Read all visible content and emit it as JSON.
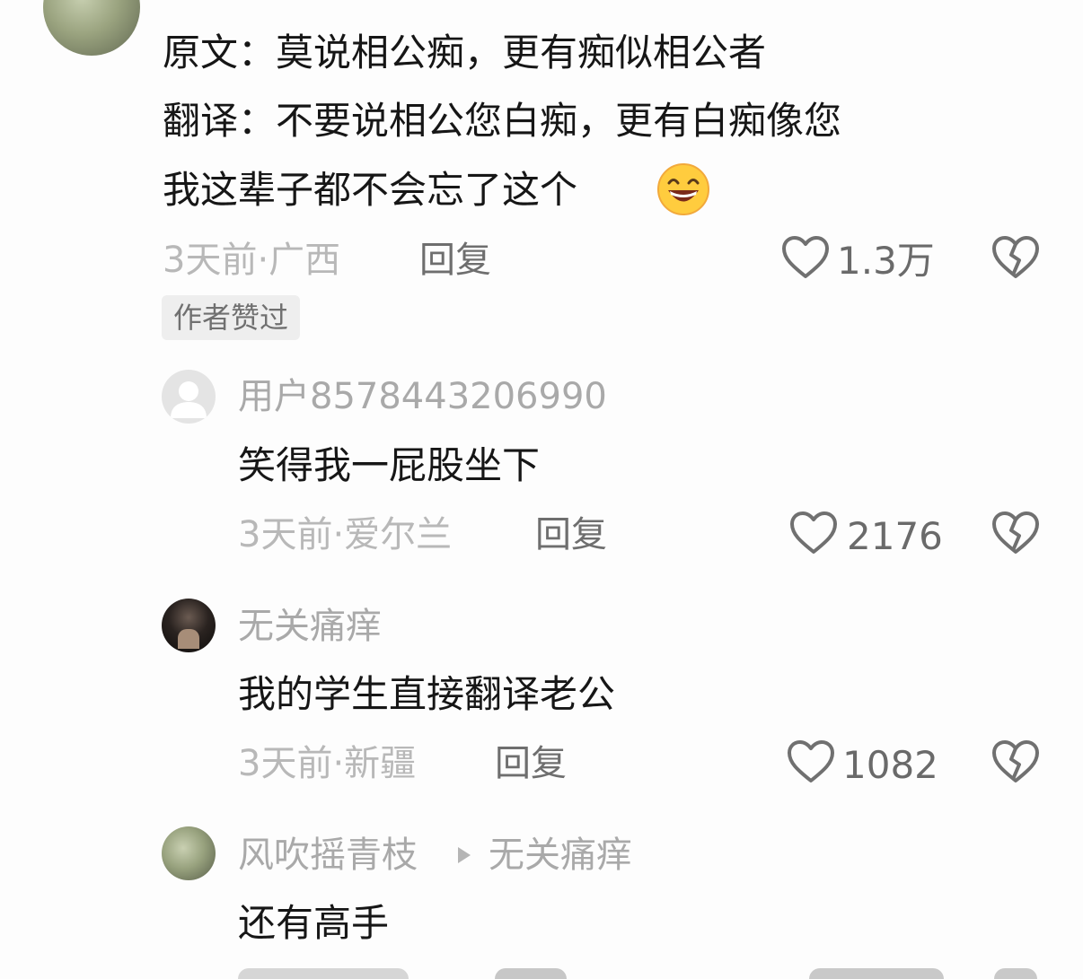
{
  "top_comment": {
    "text_line1": "原文：莫说相公痴，更有痴似相公者",
    "text_line2": "翻译：不要说相公您白痴，更有白痴像您",
    "text_line3": "我这辈子都不会忘了这个",
    "emoji": "grinning-face-emoji",
    "time_location": "3天前·广西",
    "reply_label": "回复",
    "like_count": "1.3万",
    "badge": "作者赞过"
  },
  "replies": [
    {
      "username": "用户8578443206990",
      "text": "笑得我一屁股坐下",
      "time_location": "3天前·爱尔兰",
      "reply_label": "回复",
      "like_count": "2176"
    },
    {
      "username": "无关痛痒",
      "text": "我的学生直接翻译老公",
      "time_location": "3天前·新疆",
      "reply_label": "回复",
      "like_count": "1082"
    },
    {
      "username": "风吹摇青枝",
      "reply_to": "无关痛痒",
      "text": "还有高手"
    }
  ],
  "colors": {
    "primary_text": "#161616",
    "meta_text": "#b8b8b8",
    "icon": "#707070",
    "badge_bg": "#eeeeee"
  }
}
